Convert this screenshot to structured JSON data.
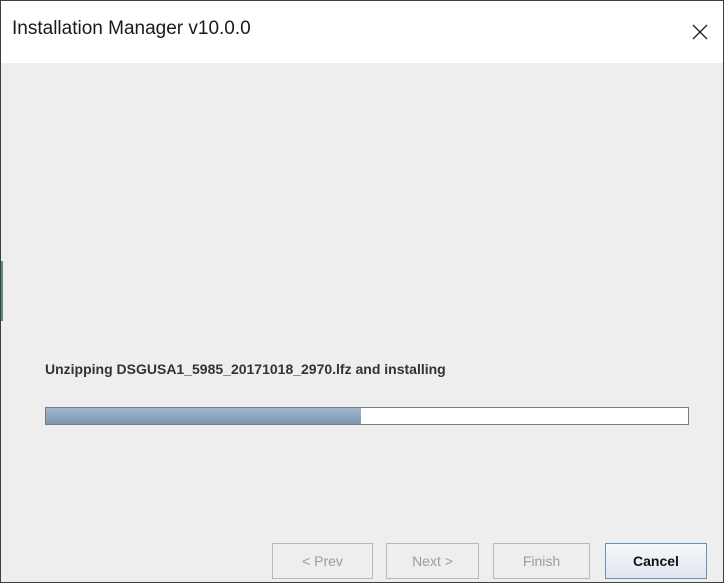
{
  "window": {
    "title": "Installation Manager v10.0.0"
  },
  "install": {
    "status_text": "Unzipping DSGUSA1_5985_20171018_2970.lfz and installing",
    "progress_percent": 49
  },
  "buttons": {
    "prev_label": "< Prev",
    "next_label": "Next >",
    "finish_label": "Finish",
    "cancel_label": "Cancel"
  },
  "colors": {
    "progress_fill": "#8aa5c1",
    "window_bg": "#eeeeee",
    "titlebar_bg": "#ffffff"
  },
  "icons": {
    "close": "close-icon"
  }
}
